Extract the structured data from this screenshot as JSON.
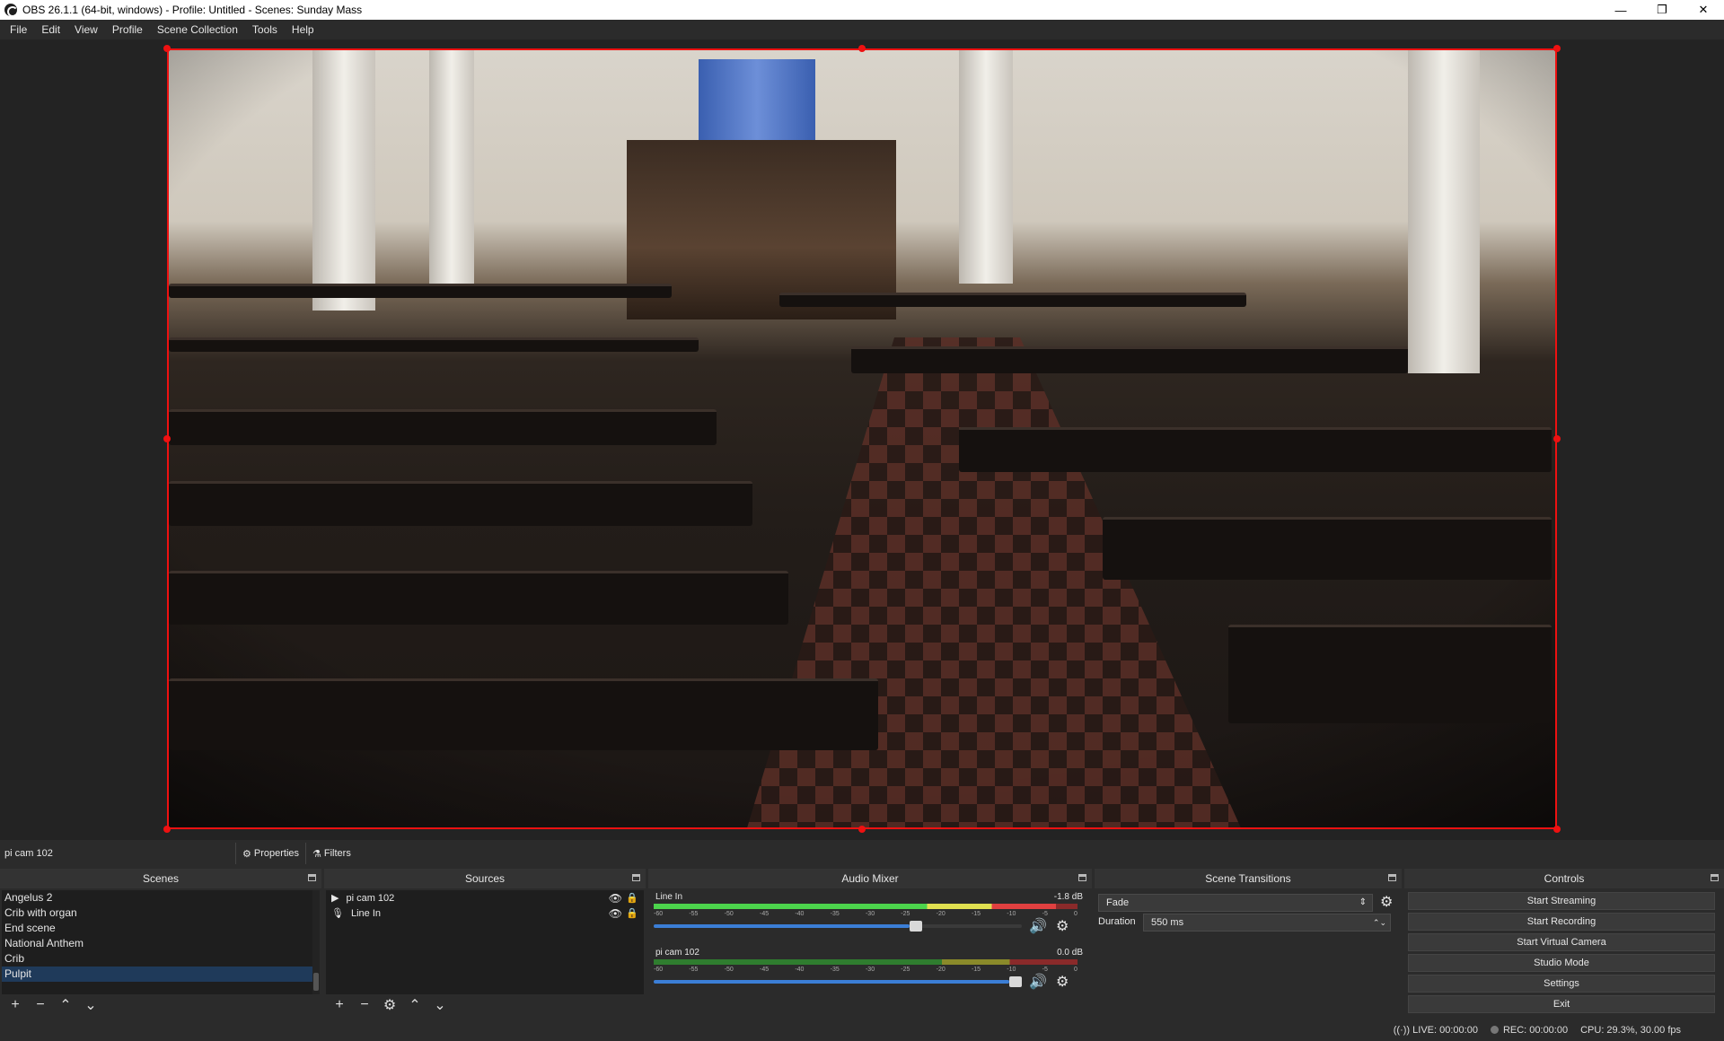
{
  "window": {
    "title": "OBS 26.1.1 (64-bit, windows) - Profile: Untitled - Scenes: Sunday Mass",
    "minimize": "—",
    "restore": "❐",
    "close": "✕"
  },
  "menu": [
    "File",
    "Edit",
    "View",
    "Profile",
    "Scene Collection",
    "Tools",
    "Help"
  ],
  "source_toolbar": {
    "current_source": "pi cam 102",
    "properties_label": "Properties",
    "filters_label": "Filters"
  },
  "scenes": {
    "title": "Scenes",
    "items": [
      "Angelus 2",
      "Crib with organ",
      "End scene",
      "National Anthem",
      "Crib",
      "Pulpit"
    ],
    "selected": "Pulpit"
  },
  "sources": {
    "title": "Sources",
    "items": [
      {
        "name": "pi cam 102",
        "icon": "play-icon"
      },
      {
        "name": "Line In",
        "icon": "microphone-icon"
      }
    ]
  },
  "audio_mixer": {
    "title": "Audio Mixer",
    "tick_labels": [
      "-60",
      "-55",
      "-50",
      "-45",
      "-40",
      "-35",
      "-30",
      "-25",
      "-20",
      "-15",
      "-10",
      "-5",
      "0"
    ],
    "channels": [
      {
        "name": "Line In",
        "db": "-1.8 dB",
        "fader_level": 0.72,
        "meter_level": 0.95
      },
      {
        "name": "pi cam 102",
        "db": "0.0 dB",
        "fader_level": 1.0,
        "meter_level": 0.0
      }
    ]
  },
  "scene_transitions": {
    "title": "Scene Transitions",
    "transition": "Fade",
    "duration_label": "Duration",
    "duration_value": "550 ms"
  },
  "controls": {
    "title": "Controls",
    "start_streaming": "Start Streaming",
    "start_recording": "Start Recording",
    "start_virtual_camera": "Start Virtual Camera",
    "studio_mode": "Studio Mode",
    "settings": "Settings",
    "exit": "Exit"
  },
  "status": {
    "live": "LIVE: 00:00:00",
    "rec": "REC: 00:00:00",
    "cpu": "CPU: 29.3%, 30.00 fps"
  },
  "colors": {
    "selection_border": "#ee1111",
    "selected_scene": "#1f3a5a",
    "fader_blue": "#3b7ed6"
  }
}
